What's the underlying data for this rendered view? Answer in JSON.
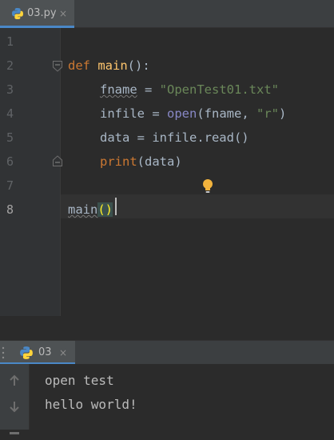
{
  "editor_tab": {
    "filename": "03.py",
    "close": "×"
  },
  "line_numbers": [
    "1",
    "2",
    "3",
    "4",
    "5",
    "6",
    "7",
    "8"
  ],
  "code": {
    "l2": {
      "kw": "def",
      "name": "main",
      "rest": "():"
    },
    "l3": {
      "var": "fname",
      "eq": " = ",
      "str": "\"OpenTest01.txt\""
    },
    "l4": {
      "pre": "infile = ",
      "builtin": "open",
      "open_paren": "(",
      "arg": "fname, ",
      "str": "\"r\"",
      "close_paren": ")"
    },
    "l5": {
      "text": "data = infile.read()"
    },
    "l6": {
      "builtin": "print",
      "rest": "(data)"
    },
    "l8": {
      "call": "main",
      "open": "(",
      "close": ")"
    }
  },
  "run_tab": {
    "label": "03",
    "close": "×"
  },
  "console_output": [
    "open test",
    "hello world!"
  ],
  "colors": {
    "background": "#2b2b2b",
    "keyword": "#cc7832",
    "function": "#ffc66d",
    "string": "#6a8759",
    "accent": "#4a88c7"
  }
}
